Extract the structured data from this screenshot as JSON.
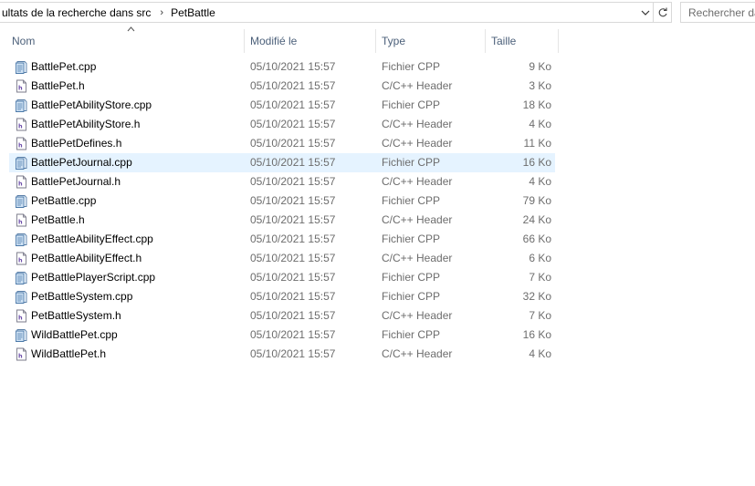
{
  "address": {
    "crumbs": [
      "ultats de la recherche dans src",
      "PetBattle"
    ],
    "search_placeholder": "Rechercher dans"
  },
  "columns": {
    "name": "Nom",
    "modified": "Modifié le",
    "type": "Type",
    "size": "Taille"
  },
  "files": [
    {
      "name": "BattlePet.cpp",
      "modified": "05/10/2021 15:57",
      "type": "Fichier CPP",
      "size": "9 Ko",
      "icon": "cpp-file-icon"
    },
    {
      "name": "BattlePet.h",
      "modified": "05/10/2021 15:57",
      "type": "C/C++ Header",
      "size": "3 Ko",
      "icon": "header-file-icon"
    },
    {
      "name": "BattlePetAbilityStore.cpp",
      "modified": "05/10/2021 15:57",
      "type": "Fichier CPP",
      "size": "18 Ko",
      "icon": "cpp-file-icon"
    },
    {
      "name": "BattlePetAbilityStore.h",
      "modified": "05/10/2021 15:57",
      "type": "C/C++ Header",
      "size": "4 Ko",
      "icon": "header-file-icon"
    },
    {
      "name": "BattlePetDefines.h",
      "modified": "05/10/2021 15:57",
      "type": "C/C++ Header",
      "size": "11 Ko",
      "icon": "header-file-icon"
    },
    {
      "name": "BattlePetJournal.cpp",
      "modified": "05/10/2021 15:57",
      "type": "Fichier CPP",
      "size": "16 Ko",
      "icon": "cpp-file-icon",
      "selected": true
    },
    {
      "name": "BattlePetJournal.h",
      "modified": "05/10/2021 15:57",
      "type": "C/C++ Header",
      "size": "4 Ko",
      "icon": "header-file-icon"
    },
    {
      "name": "PetBattle.cpp",
      "modified": "05/10/2021 15:57",
      "type": "Fichier CPP",
      "size": "79 Ko",
      "icon": "cpp-file-icon"
    },
    {
      "name": "PetBattle.h",
      "modified": "05/10/2021 15:57",
      "type": "C/C++ Header",
      "size": "24 Ko",
      "icon": "header-file-icon"
    },
    {
      "name": "PetBattleAbilityEffect.cpp",
      "modified": "05/10/2021 15:57",
      "type": "Fichier CPP",
      "size": "66 Ko",
      "icon": "cpp-file-icon"
    },
    {
      "name": "PetBattleAbilityEffect.h",
      "modified": "05/10/2021 15:57",
      "type": "C/C++ Header",
      "size": "6 Ko",
      "icon": "header-file-icon"
    },
    {
      "name": "PetBattlePlayerScript.cpp",
      "modified": "05/10/2021 15:57",
      "type": "Fichier CPP",
      "size": "7 Ko",
      "icon": "cpp-file-icon"
    },
    {
      "name": "PetBattleSystem.cpp",
      "modified": "05/10/2021 15:57",
      "type": "Fichier CPP",
      "size": "32 Ko",
      "icon": "cpp-file-icon"
    },
    {
      "name": "PetBattleSystem.h",
      "modified": "05/10/2021 15:57",
      "type": "C/C++ Header",
      "size": "7 Ko",
      "icon": "header-file-icon"
    },
    {
      "name": "WildBattlePet.cpp",
      "modified": "05/10/2021 15:57",
      "type": "Fichier CPP",
      "size": "16 Ko",
      "icon": "cpp-file-icon"
    },
    {
      "name": "WildBattlePet.h",
      "modified": "05/10/2021 15:57",
      "type": "C/C++ Header",
      "size": "4 Ko",
      "icon": "header-file-icon"
    }
  ],
  "colors": {
    "selection": "#e5f3ff",
    "header_text": "#4c607a",
    "secondary_text": "#6d6d6d"
  }
}
